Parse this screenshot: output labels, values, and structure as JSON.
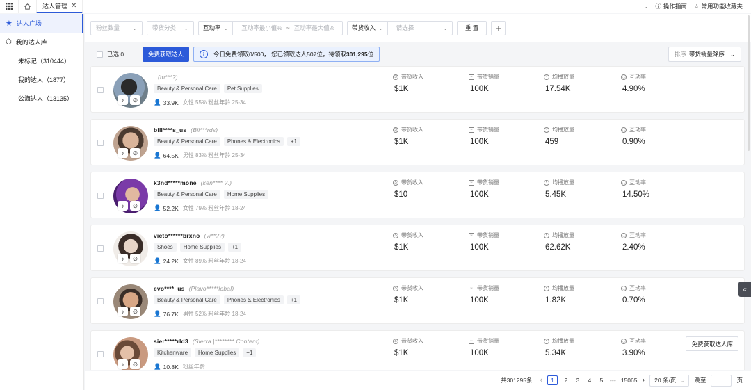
{
  "header": {
    "tab_label": "达人管理",
    "tab_close": "✕",
    "guide": "操作指南",
    "favorites": "常用功能收藏夹"
  },
  "sidebar": {
    "items": [
      {
        "label": "达人广场"
      },
      {
        "label": "我的达人库"
      },
      {
        "label": "未标记（310444）"
      },
      {
        "label": "我的达人（1877）"
      },
      {
        "label": "公海达人（13135）"
      }
    ]
  },
  "filters": {
    "fans_count": "粉丝数量",
    "category": "带货分类",
    "interaction_label": "互动率",
    "interaction_min": "互动率最小值%",
    "range_sep": "~",
    "interaction_max": "互动率最大值%",
    "income_label": "带货收入",
    "income_placeholder": "请选择",
    "reset": "重 置",
    "add": "+"
  },
  "actions": {
    "selected": "已选 0",
    "claim_button": "免费获取达人",
    "info_prefix": "今日免费领取0/500，  您已领取达人507位，待领取",
    "info_count": "301,295",
    "info_suffix": "位",
    "sort_prefix": "排序",
    "sort_value": "带货销量降序"
  },
  "metric_labels": {
    "income": "带货收入",
    "sales": "带货销量",
    "views": "均播放量",
    "engagement": "互动率"
  },
  "creators": [
    {
      "name": "",
      "alias": "(m***?)",
      "tags": [
        "Beauty & Personal Care",
        "Pet Supplies"
      ],
      "fans": "33.9K",
      "demo": "女性 55%  粉丝年龄 25-34",
      "income": "$1K",
      "sales": "100K",
      "views": "17.54K",
      "engagement": "4.90%"
    },
    {
      "name": "bill****s_us",
      "alias": "(Bil***rds)",
      "tags": [
        "Beauty & Personal Care",
        "Phones & Electronics",
        "+1"
      ],
      "fans": "64.5K",
      "demo": "男性 83%  粉丝年龄 25-34",
      "income": "$1K",
      "sales": "100K",
      "views": "459",
      "engagement": "0.90%"
    },
    {
      "name": "k3nd*****mone",
      "alias": "(ken**** ?.)",
      "tags": [
        "Beauty & Personal Care",
        "Home Supplies"
      ],
      "fans": "52.2K",
      "demo": "女性 79%  粉丝年龄 18-24",
      "income": "$10",
      "sales": "100K",
      "views": "5.45K",
      "engagement": "14.50%"
    },
    {
      "name": "victo******brxno",
      "alias": "(vi**??)",
      "tags": [
        "Shoes",
        "Home Supplies",
        "+1"
      ],
      "fans": "24.2K",
      "demo": "女性 89%  粉丝年龄 18-24",
      "income": "$1K",
      "sales": "100K",
      "views": "62.62K",
      "engagement": "2.40%"
    },
    {
      "name": "evo****_us",
      "alias": "(Plavo*****lobal)",
      "tags": [
        "Beauty & Personal Care",
        "Phones & Electronics",
        "+1"
      ],
      "fans": "76.7K",
      "demo": "男性 52%  粉丝年龄 18-24",
      "income": "$1K",
      "sales": "100K",
      "views": "1.82K",
      "engagement": "0.70%"
    },
    {
      "name": "sier*****rld3",
      "alias": "(Sierra |******** Content)",
      "tags": [
        "Kitchenware",
        "Home Supplies",
        "+1"
      ],
      "fans": "10.8K",
      "demo": "粉丝年龄",
      "income": "$1K",
      "sales": "100K",
      "views": "5.34K",
      "engagement": "3.90%",
      "button": "免费获取达人库"
    }
  ],
  "pagination": {
    "total": "共301295条",
    "prev": "‹",
    "pages": [
      "1",
      "2",
      "3",
      "4",
      "5"
    ],
    "ellipsis": "•••",
    "last": "15065",
    "next": "›",
    "page_size": "20 条/页",
    "jump_label": "跳至",
    "jump_suffix": "页"
  },
  "colors": {
    "accent": "#2c5ad9"
  }
}
